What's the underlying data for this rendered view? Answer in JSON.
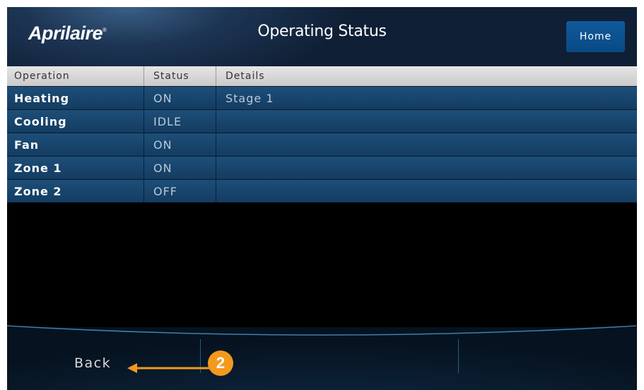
{
  "header": {
    "logo": "Aprilaire",
    "logo_mark": "®",
    "title": "Operating Status",
    "home_label": "Home"
  },
  "table": {
    "columns": [
      "Operation",
      "Status",
      "Details"
    ],
    "rows": [
      {
        "operation": "Heating",
        "status": "ON",
        "details": "Stage 1"
      },
      {
        "operation": "Cooling",
        "status": "IDLE",
        "details": ""
      },
      {
        "operation": "Fan",
        "status": "ON",
        "details": ""
      },
      {
        "operation": "Zone 1",
        "status": "ON",
        "details": ""
      },
      {
        "operation": "Zone 2",
        "status": "OFF",
        "details": ""
      }
    ]
  },
  "footer": {
    "back_label": "Back"
  },
  "callout": {
    "number": "2",
    "color": "#f39a1e"
  }
}
